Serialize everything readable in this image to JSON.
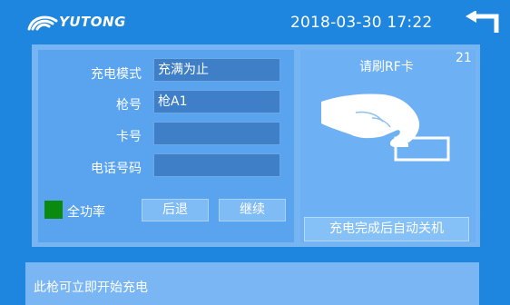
{
  "header": {
    "brand": "YUTONG",
    "datetime": "2018-03-30 17:22",
    "back_icon": "return-arrow-icon",
    "logo_icon": "yutong-wave-icon"
  },
  "form": {
    "fields": [
      {
        "label": "充电模式",
        "value": "充满为止"
      },
      {
        "label": "枪号",
        "value": "枪A1"
      },
      {
        "label": "卡号",
        "value": ""
      },
      {
        "label": "电话号码",
        "value": ""
      }
    ],
    "indicator": {
      "label": "全功率",
      "color": "#0b8a10"
    },
    "buttons": {
      "back": "后退",
      "continue": "继续"
    }
  },
  "rf_panel": {
    "title": "请刷RF卡",
    "countdown": "21",
    "image_icon": "hand-swipe-card-icon",
    "auto_off_button": "充电完成后自动关机"
  },
  "status": {
    "message": "此枪可立即开始充电"
  },
  "colors": {
    "background": "#1e86de",
    "indicator": "#0b8a10"
  }
}
